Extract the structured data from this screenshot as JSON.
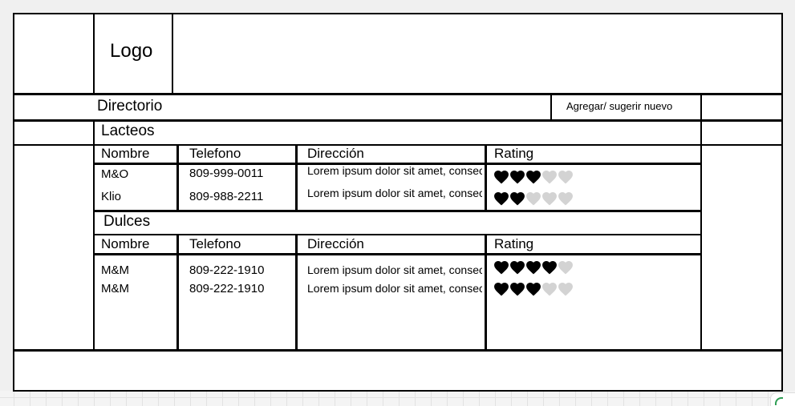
{
  "header": {
    "logo_text": "Logo"
  },
  "directory": {
    "title": "Directorio",
    "suggest_button": "Agregar/ sugerir nuevo"
  },
  "columns": [
    "Nombre",
    "Telefono",
    "Dirección",
    "Rating"
  ],
  "categories": [
    {
      "title": "Lacteos",
      "rows": [
        {
          "name": "M&O",
          "phone": "809-999-0011",
          "address": "Lorem ipsum dolor sit amet, consectetur adipiscing elit",
          "rating": 3,
          "rating_max": 5
        },
        {
          "name": "Klio",
          "phone": "809-988-2211",
          "address": "Lorem ipsum dolor sit amet, consectetur adipiscing elit",
          "rating": 2,
          "rating_max": 5
        }
      ]
    },
    {
      "title": "Dulces",
      "rows": [
        {
          "name": "M&M",
          "phone": "809-222-1910",
          "address": "Lorem ipsum dolor sit amet, consectetur adipiscing elit",
          "rating": 4,
          "rating_max": 5
        },
        {
          "name": "M&M",
          "phone": "809-222-1910",
          "address": "Lorem ipsum dolor sit amet, consectetur adipiscing elit",
          "rating": 3,
          "rating_max": 5
        }
      ]
    }
  ],
  "colors": {
    "heart_filled": "#000000",
    "heart_empty": "#d3d3d3",
    "line": "#000000",
    "background": "#f0f0f0"
  },
  "icons": {
    "rating": "heart-icon"
  }
}
